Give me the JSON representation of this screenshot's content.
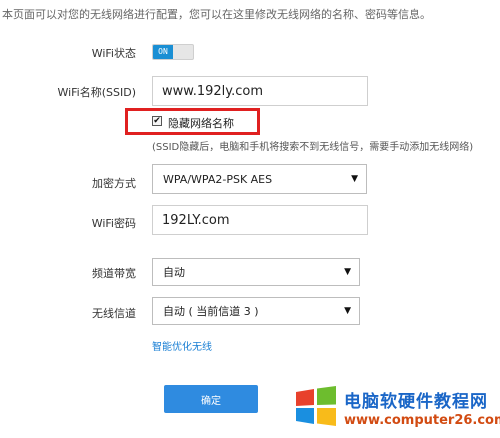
{
  "intro": "本页面可以对您的无线网络进行配置，您可以在这里修改无线网络的名称、密码等信息。",
  "wifi_status": {
    "label": "WiFi状态",
    "toggle_text": "ON"
  },
  "ssid": {
    "label": "WiFi名称(SSID)",
    "value": "www.192ly.com"
  },
  "hide_ssid": {
    "checkbox_mark": "✔",
    "label": "隐藏网络名称",
    "hint": "(SSID隐藏后，电脑和手机将搜索不到无线信号，需要手动添加无线网络)"
  },
  "encryption": {
    "label": "加密方式",
    "value": "WPA/WPA2-PSK AES"
  },
  "password": {
    "label": "WiFi密码",
    "value": "192LY.com"
  },
  "bandwidth": {
    "label": "频道带宽",
    "value": "自动"
  },
  "channel": {
    "label": "无线信道",
    "value": "自动 ( 当前信道 3 )"
  },
  "smart_optimize_link": "智能优化无线",
  "confirm_button": "确定",
  "watermark": {
    "title": "电脑软硬件教程网",
    "url": "www.computer26.com"
  },
  "colors": {
    "accent": "#2f8be0",
    "toggle_on": "#1a8fd4",
    "highlight_box": "#e02020",
    "link": "#1a7fd4"
  }
}
